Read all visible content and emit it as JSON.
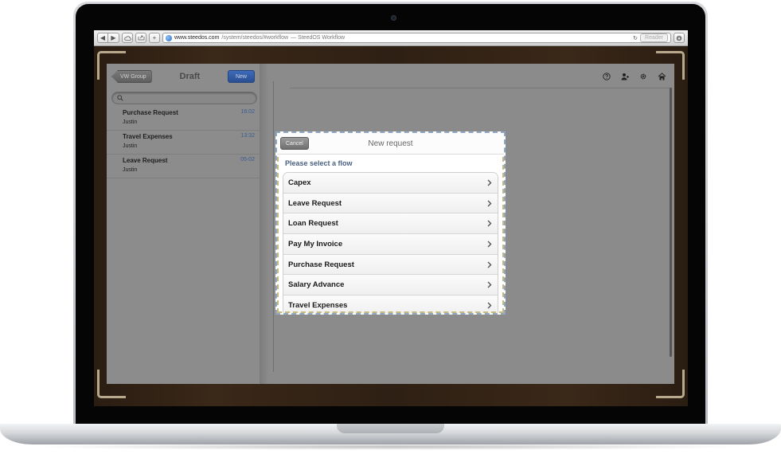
{
  "browser": {
    "url_domain": "www.steedos.com",
    "url_path": "/system/steedos/#workflow",
    "page_title_suffix": " — SteedOS Workflow",
    "reader_label": "Reader",
    "add_label": "+"
  },
  "master": {
    "back_label": "VW Group",
    "title": "Draft",
    "new_label": "New",
    "search_placeholder": "",
    "items": [
      {
        "title": "Purchase Request",
        "user": "Justin",
        "time": "16:02"
      },
      {
        "title": "Travel Expenses",
        "user": "Justin",
        "time": "13:32"
      },
      {
        "title": "Leave Request",
        "user": "Justin",
        "time": "05-02"
      }
    ]
  },
  "toolbar": {
    "icons": [
      "help-icon",
      "user-add-icon",
      "gear-icon",
      "home-icon"
    ]
  },
  "modal": {
    "cancel_label": "Cancel",
    "title": "New request",
    "section_label": "Please select a flow",
    "flows": [
      "Capex",
      "Leave Request",
      "Loan Request",
      "Pay My Invoice",
      "Purchase Request",
      "Salary Advance",
      "Travel Expenses"
    ]
  },
  "colors": {
    "accent_blue": "#2a4f92",
    "section_label": "#4a5f82",
    "time_text": "#3a5b93"
  }
}
